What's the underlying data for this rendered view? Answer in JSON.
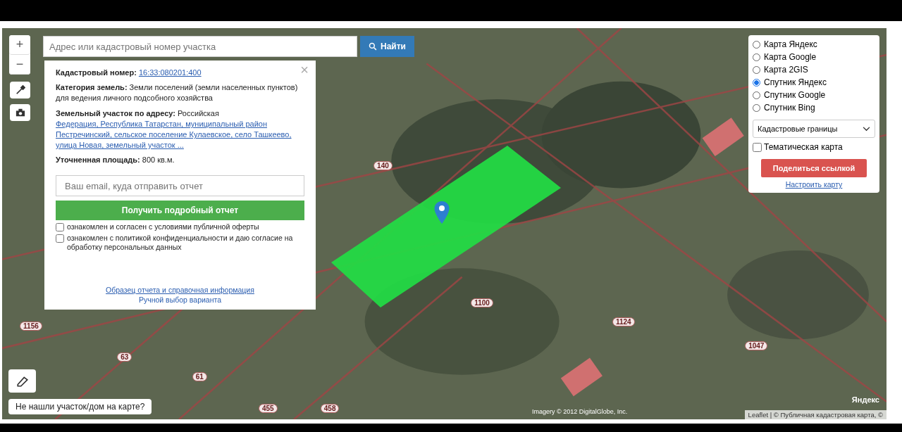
{
  "search": {
    "placeholder": "Адрес или кадастровый номер участка",
    "button": "Найти"
  },
  "zoom_controls": [
    "+",
    "−"
  ],
  "info_card": {
    "close": "×",
    "cadastral_label": "Кадастровый номер:",
    "cadastral_number": "16:33:080201:400",
    "category_label": "Категория земель:",
    "category_value": "Земли поселений (земли населенных пунктов)",
    "usage": "для ведения личного подсобного хозяйства",
    "address_label": "Земельный участок по адресу:",
    "address_start": "Российская",
    "address_link": "Федерация, Республика Татарстан, муниципальный район Пестречинский, сельское поселение Кулаевское, село Ташкеево, улица Новая, земельный участок ...",
    "area_label": "Уточненная площадь:",
    "area_value": "800 кв.м.",
    "email_placeholder": "Ваш email, куда отправить отчет",
    "report_button": "Получить подробный отчет",
    "consents": [
      {
        "text": "ознакомлен и согласен с условиями публичной оферты",
        "checked": false
      },
      {
        "text": "ознакомлен с политикой конфиденциальности и даю согласие на обработку персональных данных",
        "checked": false
      }
    ],
    "links": [
      "Образец отчета и справочная информация",
      "Ручной выбор варианта"
    ]
  },
  "layers": [
    {
      "label": "Карта Яндекс",
      "selected": false
    },
    {
      "label": "Карта Google",
      "selected": false
    },
    {
      "label": "Карта 2GIS",
      "selected": false
    },
    {
      "label": "Спутник Яндекс",
      "selected": true
    },
    {
      "label": "Спутник Google",
      "selected": false
    },
    {
      "label": "Спутник Bing",
      "selected": false
    }
  ],
  "overlay_select": "Кадастровые границы",
  "thematic": {
    "label": "Тематическая карта",
    "checked": false
  },
  "share_button": "Поделиться ссылкой",
  "configure_link": "Настроить карту",
  "not_found_button": "Не нашли участок/дом на карте?",
  "parcel_labels": [
    "140",
    "1100",
    "1124",
    "1156",
    "63",
    "61",
    "455",
    "458",
    "1047"
  ],
  "attribution_left": "Imagery © 2012 DigitalGlobe, Inc.",
  "yandex_logo": "Яндекс",
  "attribution_right": "Leaflet | © Публичная кадастровая карта, ©"
}
